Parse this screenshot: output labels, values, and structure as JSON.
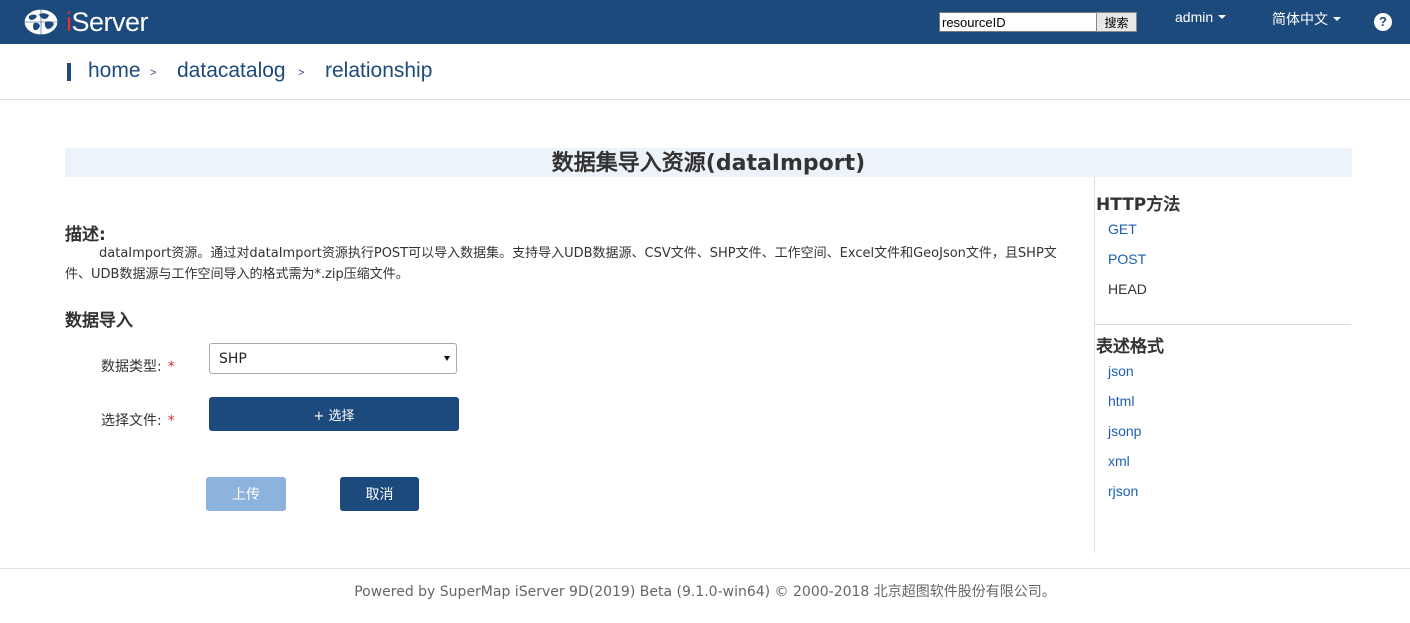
{
  "header": {
    "logo_text": "iServer",
    "search_value": "resourceID",
    "search_button": "搜索",
    "user_menu": "admin",
    "language_menu": "简体中文",
    "help_label": "?"
  },
  "breadcrumb": {
    "items": [
      "home",
      "datacatalog",
      "relationship"
    ],
    "separator": ">"
  },
  "page": {
    "title": "数据集导入资源(dataImport)",
    "description_heading": "描述:",
    "description": "dataImport资源。通过对dataImport资源执行POST可以导入数据集。支持导入UDB数据源、CSV文件、SHP文件、工作空间、Excel文件和GeoJson文件，且SHP文件、UDB数据源与工作空间导入的格式需为*.zip压缩文件。",
    "import_heading": "数据导入",
    "data_type_label": "数据类型:",
    "data_type_value": "SHP",
    "file_label": "选择文件:",
    "required_mark": "*",
    "choose_button": "+ 选择",
    "upload_button": "上传",
    "cancel_button": "取消"
  },
  "sidebar": {
    "http_heading": "HTTP方法",
    "methods": [
      "GET",
      "POST",
      "HEAD"
    ],
    "format_heading": "表述格式",
    "formats": [
      "json",
      "html",
      "jsonp",
      "xml",
      "rjson"
    ]
  },
  "footer": {
    "text": "Powered by SuperMap iServer 9D(2019) Beta (9.1.0-win64) © 2000-2018 北京超图软件股份有限公司。"
  },
  "colors": {
    "header_bg": "#1d4a7d",
    "link": "#1d5fb0",
    "title_band": "#edf3fa",
    "upload_disabled": "#8db3dc"
  }
}
